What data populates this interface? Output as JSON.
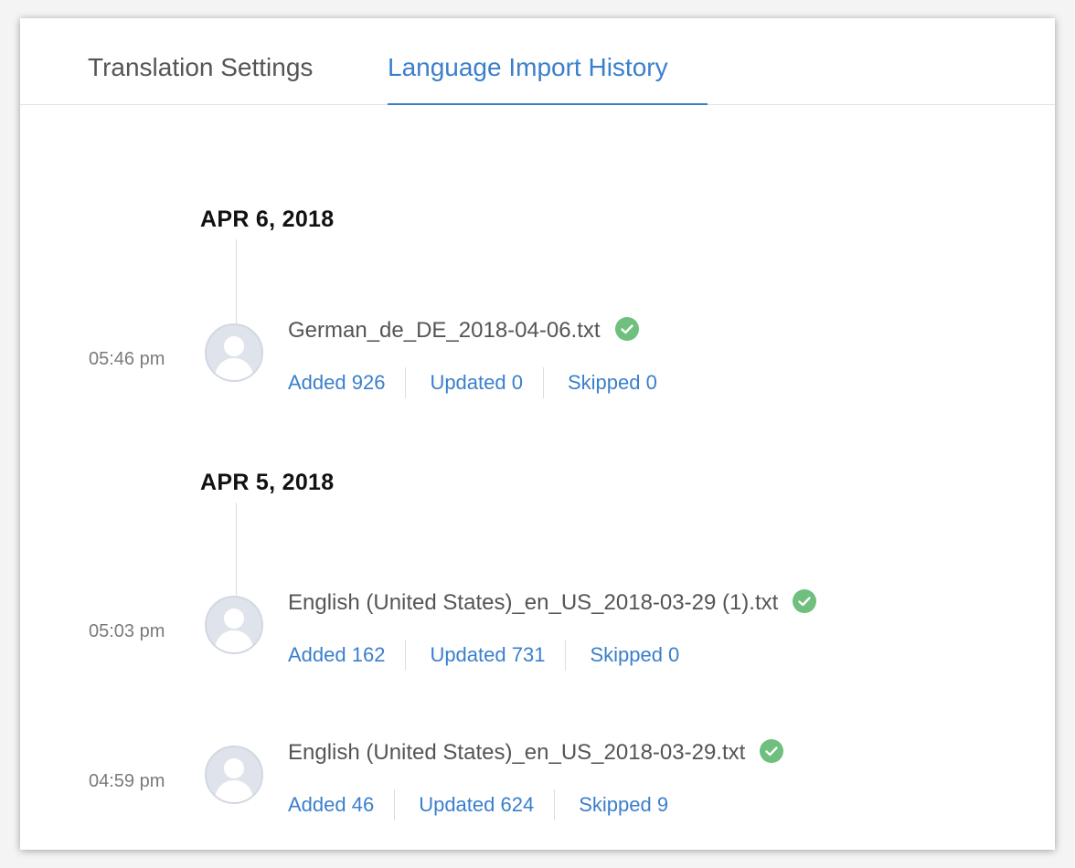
{
  "tabs": [
    {
      "label": "Translation Settings",
      "active": false
    },
    {
      "label": "Language Import History",
      "active": true
    }
  ],
  "colors": {
    "accent": "#3a7fcc",
    "success": "#6fbf7e",
    "text": "#555555"
  },
  "groups": [
    {
      "date": "APR 6, 2018",
      "entries": [
        {
          "time": "05:46 pm",
          "file": "German_de_DE_2018-04-06.txt",
          "status_icon": "check-circle-icon",
          "added": "Added 926",
          "updated": "Updated 0",
          "skipped": "Skipped 0"
        }
      ]
    },
    {
      "date": "APR 5, 2018",
      "entries": [
        {
          "time": "05:03 pm",
          "file": "English (United States)_en_US_2018-03-29 (1).txt",
          "status_icon": "check-circle-icon",
          "added": "Added 162",
          "updated": "Updated 731",
          "skipped": "Skipped 0"
        },
        {
          "time": "04:59 pm",
          "file": "English (United States)_en_US_2018-03-29.txt",
          "status_icon": "check-circle-icon",
          "added": "Added 46",
          "updated": "Updated 624",
          "skipped": "Skipped 9"
        }
      ]
    }
  ]
}
